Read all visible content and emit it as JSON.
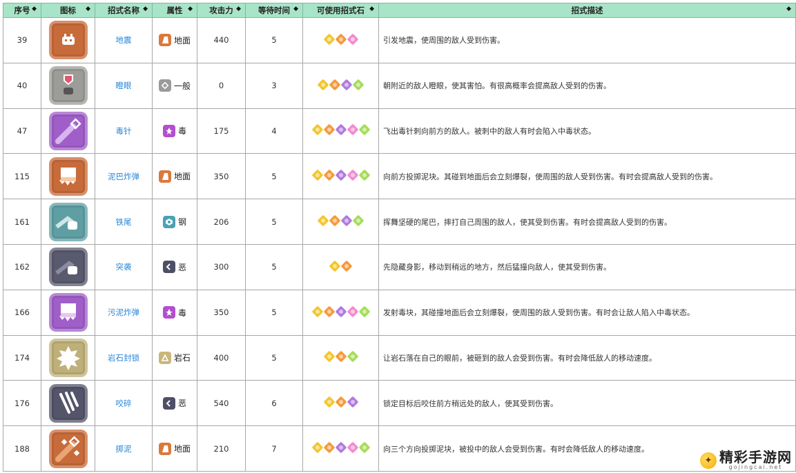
{
  "headers": {
    "index": "序号",
    "icon": "图标",
    "name": "招式名称",
    "attr": "属性",
    "power": "攻击力",
    "cooldown": "等待时间",
    "stones": "可使用招式石",
    "desc": "招式描述",
    "sort_glyph": "◆"
  },
  "stone_colors": {
    "yellow": "#f3c62c",
    "orange": "#f59a3a",
    "purple": "#b07be0",
    "pink": "#f28bcf",
    "green": "#a6dc5a"
  },
  "attr_colors": {
    "地面": "#d97a3c",
    "一般": "#9a9a9a",
    "毒": "#b24fcf",
    "钢": "#4aa2b4",
    "恶": "#4d4f66",
    "岩石": "#c9b67a"
  },
  "rows": [
    {
      "index": "39",
      "icon": "earthquake-icon",
      "icon_bg": "#c86b3a",
      "name": "地震",
      "attr": "地面",
      "attr_icon": "ground-icon",
      "power": "440",
      "cooldown": "5",
      "stones": [
        "yellow",
        "orange",
        "pink"
      ],
      "desc": "引发地震，使周围的敌人受到伤害。"
    },
    {
      "index": "40",
      "icon": "glare-icon",
      "icon_bg": "#9c9c98",
      "name": "瞪眼",
      "attr": "一般",
      "attr_icon": "normal-icon",
      "power": "0",
      "cooldown": "3",
      "stones": [
        "yellow",
        "orange",
        "purple",
        "green"
      ],
      "desc": "朝附近的敌人瞪眼，使其害怕。有很高概率会提高敌人受到的伤害。"
    },
    {
      "index": "47",
      "icon": "poison-needle-icon",
      "icon_bg": "#a05fc8",
      "name": "毒针",
      "attr": "毒",
      "attr_icon": "poison-icon",
      "power": "175",
      "cooldown": "4",
      "stones": [
        "yellow",
        "orange",
        "purple",
        "pink",
        "green"
      ],
      "desc": "飞出毒针刺向前方的敌人。被刺中的敌人有时会陷入中毒状态。"
    },
    {
      "index": "115",
      "icon": "mud-bomb-icon",
      "icon_bg": "#c86b3a",
      "name": "泥巴炸弹",
      "attr": "地面",
      "attr_icon": "ground-icon",
      "power": "350",
      "cooldown": "5",
      "stones": [
        "yellow",
        "orange",
        "purple",
        "pink",
        "green"
      ],
      "desc": "向前方投掷泥块。其碰到地面后会立刻爆裂，使周围的敌人受到伤害。有时会提高敌人受到的伤害。"
    },
    {
      "index": "161",
      "icon": "iron-tail-icon",
      "icon_bg": "#5f9fa4",
      "name": "铁尾",
      "attr": "钢",
      "attr_icon": "steel-icon",
      "power": "206",
      "cooldown": "5",
      "stones": [
        "yellow",
        "orange",
        "purple",
        "green"
      ],
      "desc": "挥舞坚硬的尾巴，摔打自己周围的敌人，使其受到伤害。有时会提高敌人受到的伤害。"
    },
    {
      "index": "162",
      "icon": "assault-icon",
      "icon_bg": "#5a5a6e",
      "name": "突袭",
      "attr": "恶",
      "attr_icon": "dark-icon",
      "power": "300",
      "cooldown": "5",
      "stones": [
        "yellow",
        "orange"
      ],
      "desc": "先隐藏身影，移动到稍远的地方，然后猛撞向敌人，使其受到伤害。"
    },
    {
      "index": "166",
      "icon": "sludge-bomb-icon",
      "icon_bg": "#a05fc8",
      "name": "污泥炸弹",
      "attr": "毒",
      "attr_icon": "poison-icon",
      "power": "350",
      "cooldown": "5",
      "stones": [
        "yellow",
        "orange",
        "purple",
        "pink",
        "green"
      ],
      "desc": "发射毒块，其碰撞地面后会立刻爆裂，使周围的敌人受到伤害。有时会让敌人陷入中毒状态。"
    },
    {
      "index": "174",
      "icon": "rock-lock-icon",
      "icon_bg": "#bfb07a",
      "name": "岩石封锁",
      "attr": "岩石",
      "attr_icon": "rock-icon",
      "power": "400",
      "cooldown": "5",
      "stones": [
        "yellow",
        "orange",
        "green"
      ],
      "desc": "让岩石落在自己的眼前，被砸到的敌人会受到伤害。有时会降低敌人的移动速度。"
    },
    {
      "index": "176",
      "icon": "crunch-icon",
      "icon_bg": "#54546a",
      "name": "咬碎",
      "attr": "恶",
      "attr_icon": "dark-icon",
      "power": "540",
      "cooldown": "6",
      "stones": [
        "yellow",
        "orange",
        "purple"
      ],
      "desc": "锁定目标后咬住前方稍远处的敌人，使其受到伤害。"
    },
    {
      "index": "188",
      "icon": "mud-throw-icon",
      "icon_bg": "#c86b3a",
      "name": "掷泥",
      "attr": "地面",
      "attr_icon": "ground-icon",
      "power": "210",
      "cooldown": "7",
      "stones": [
        "yellow",
        "orange",
        "purple",
        "pink",
        "green"
      ],
      "desc": "向三个方向投掷泥块，被投中的敌人会受到伤害。有时会降低敌人的移动速度。"
    }
  ],
  "watermark": {
    "title": "精彩手游网",
    "subtitle": "gojingcai.net"
  }
}
